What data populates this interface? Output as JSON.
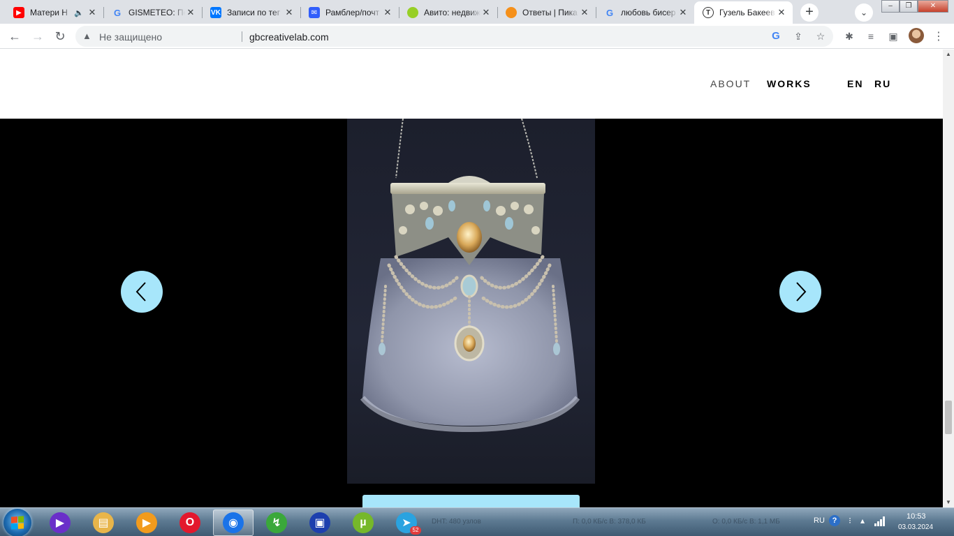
{
  "browser": {
    "tabs": [
      {
        "title": "Матери Н",
        "favicon": "youtube-icon",
        "color": "#ff0000",
        "glyph": "▶",
        "audio": true
      },
      {
        "title": "GISMETEO: По",
        "favicon": "google-icon",
        "color": "#4285f4",
        "glyph": "G"
      },
      {
        "title": "Записи по тег",
        "favicon": "vk-icon",
        "color": "#0077ff",
        "glyph": "VK"
      },
      {
        "title": "Рамблер/почт",
        "favicon": "mail-icon",
        "color": "#315efb",
        "glyph": "✉"
      },
      {
        "title": "Авито: недвиж",
        "favicon": "avito-icon",
        "color": "#97cf26",
        "glyph": "●"
      },
      {
        "title": "Ответы | Пика",
        "favicon": "pikabu-icon",
        "color": "#f5901a",
        "glyph": "●"
      },
      {
        "title": "любовь бисер",
        "favicon": "google-icon",
        "color": "#4285f4",
        "glyph": "G"
      },
      {
        "title": "Гузель Бакеев",
        "favicon": "tilda-icon",
        "color": "#ffffff",
        "glyph": "T",
        "active": true
      }
    ],
    "new_tab_label": "+",
    "address": {
      "security_label": "Не защищено",
      "url": "gbcreativelab.com"
    }
  },
  "site": {
    "nav": {
      "about": "ABOUT",
      "works": "WORKS",
      "lang_en": "EN",
      "lang_ru": "RU"
    },
    "slider": {
      "accent": "#a7e6fb",
      "background": "#000000"
    }
  },
  "taskbar": {
    "apps": [
      {
        "name": "media-player-icon",
        "color": "#6a2fc9",
        "glyph": "▶"
      },
      {
        "name": "explorer-icon",
        "color": "#e8b54a",
        "glyph": "▤"
      },
      {
        "name": "video-player-icon",
        "color": "#f29b1d",
        "glyph": "▶"
      },
      {
        "name": "opera-icon",
        "color": "#e3182d",
        "glyph": "O"
      },
      {
        "name": "chrome-icon",
        "color": "#1a73e8",
        "glyph": "◉",
        "active": true
      },
      {
        "name": "download-manager-icon",
        "color": "#3aa83a",
        "glyph": "↯"
      },
      {
        "name": "save-icon",
        "color": "#1d3fae",
        "glyph": "▣"
      },
      {
        "name": "utorrent-icon",
        "color": "#76b82a",
        "glyph": "µ"
      },
      {
        "name": "telegram-icon",
        "color": "#2aa3e0",
        "glyph": "➤",
        "badge": "52"
      }
    ],
    "faded_labels": [
      "DHT: 480 узлов",
      "П: 0,0 КБ/с В: 378,0 КБ",
      "О: 0,0 КБ/с В: 1,1 МБ"
    ],
    "tray": {
      "lang": "RU",
      "time": "10:53",
      "date": "03.03.2024"
    }
  }
}
